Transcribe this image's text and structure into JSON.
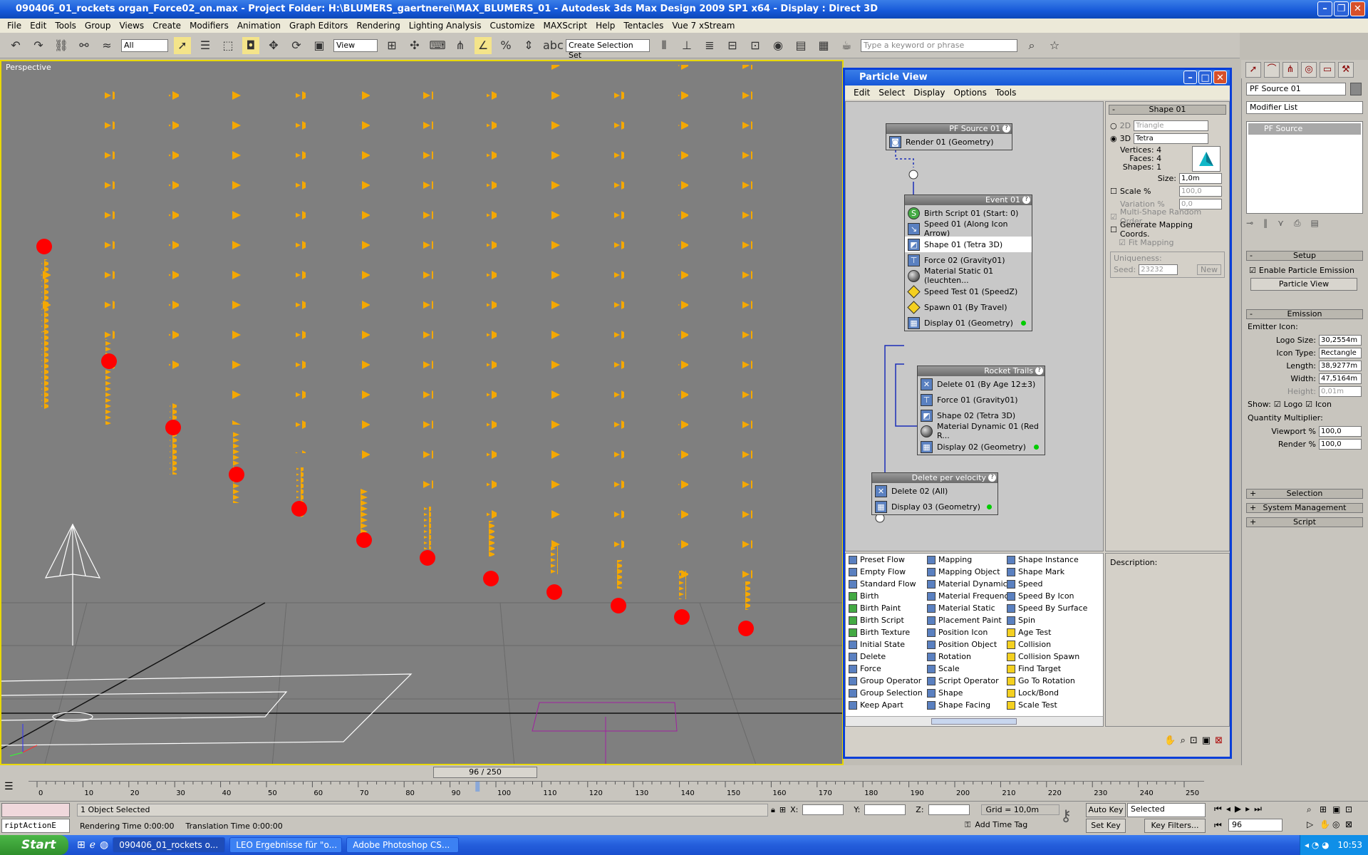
{
  "window": {
    "title": "090406_01_rockets organ_Force02_on.max     - Project Folder: H:\\BLUMERS_gaertnerei\\MAX_BLUMERS_01     - Autodesk 3ds Max Design 2009 SP1  x64      - Display : Direct 3D"
  },
  "menu": [
    "File",
    "Edit",
    "Tools",
    "Group",
    "Views",
    "Create",
    "Modifiers",
    "Animation",
    "Graph Editors",
    "Rendering",
    "Lighting Analysis",
    "Customize",
    "MAXScript",
    "Help",
    "Tentacles",
    "Vue 7 xStream"
  ],
  "toolbar": {
    "selection_filter": "All",
    "ref_coord": "View",
    "named_selection": "Create Selection Set",
    "search_placeholder": "Type a keyword or phrase"
  },
  "viewport": {
    "label": "Perspective"
  },
  "particle_view": {
    "title": "Particle View",
    "menu": [
      "Edit",
      "Select",
      "Display",
      "Options",
      "Tools"
    ],
    "pf_source": {
      "title": "PF Source 01",
      "ops": [
        "Render 01 (Geometry)"
      ]
    },
    "event01": {
      "title": "Event 01",
      "ops": [
        "Birth Script 01 (Start: 0)",
        "Speed 01 (Along Icon Arrow)",
        "Shape 01 (Tetra 3D)",
        "Force 02 (Gravity01)",
        "Material Static 01 (leuchten...",
        "Speed Test 01 (SpeedZ)",
        "Spawn 01 (By Travel)",
        "Display 01 (Geometry)"
      ]
    },
    "rocket_trails": {
      "title": "Rocket Trails",
      "ops": [
        "Delete 01 (By Age 12±3)",
        "Force 01 (Gravity01)",
        "Shape 02 (Tetra 3D)",
        "Material Dynamic 01 (Red R...",
        "Display 02 (Geometry)"
      ]
    },
    "delete_velocity": {
      "title": "Delete per velocity",
      "ops": [
        "Delete 02 (All)",
        "Display 03 (Geometry)"
      ]
    },
    "shape_panel": {
      "title": "Shape 01",
      "mode_2d": "2D",
      "shape_2d": "Triangle",
      "mode_3d": "3D",
      "shape_3d": "Tetra",
      "vertices": "Vertices: 4",
      "faces": "Faces: 4",
      "shapes": "Shapes: 1",
      "size_label": "Size:",
      "size": "1,0m",
      "scale_label": "Scale %",
      "scale": "100,0",
      "variation_label": "Variation %",
      "variation": "0,0",
      "multi_shape": "Multi-Shape Random Order",
      "gen_mapping": "Generate Mapping Coords.",
      "fit_mapping": "Fit Mapping",
      "uniqueness": "Uniqueness:",
      "seed_label": "Seed:",
      "seed": "23232",
      "new_button": "New"
    },
    "depot": {
      "col1": [
        "Preset Flow",
        "Empty Flow",
        "Standard Flow",
        "Birth",
        "Birth Paint",
        "Birth Script",
        "Birth Texture",
        "Initial State",
        "Delete",
        "Force",
        "Group Operator",
        "Group Selection",
        "Keep Apart"
      ],
      "col2": [
        "Mapping",
        "Mapping Object",
        "Material Dynamic",
        "Material Frequency",
        "Material Static",
        "Placement Paint",
        "Position Icon",
        "Position Object",
        "Rotation",
        "Scale",
        "Script Operator",
        "Shape",
        "Shape Facing"
      ],
      "col3": [
        "Shape Instance",
        "Shape Mark",
        "Speed",
        "Speed By Icon",
        "Speed By Surface",
        "Spin",
        "Age Test",
        "Collision",
        "Collision Spawn",
        "Find Target",
        "Go To Rotation",
        "Lock/Bond",
        "Scale Test"
      ]
    },
    "description_label": "Description:"
  },
  "command_panel": {
    "object_name": "PF Source 01",
    "modifier_list": "Modifier List",
    "stack_item": "PF Source",
    "setup": {
      "title": "Setup",
      "enable_emission": "Enable Particle Emission",
      "particle_view_button": "Particle View"
    },
    "emission": {
      "title": "Emission",
      "emitter_icon": "Emitter Icon:",
      "logo_size_label": "Logo Size:",
      "logo_size": "30,2554m",
      "icon_type_label": "Icon Type:",
      "icon_type": "Rectangle",
      "length_label": "Length:",
      "length": "38,9277m",
      "width_label": "Width:",
      "width": "47,5164m",
      "height_label": "Height:",
      "height": "0,01m",
      "show_label": "Show:",
      "logo_check": "Logo",
      "icon_check": "Icon",
      "quantity": "Quantity Multiplier:",
      "viewport_label": "Viewport %",
      "viewport_value": "100,0",
      "render_label": "Render %",
      "render_value": "100,0"
    },
    "rollouts": [
      "Selection",
      "System Management",
      "Script"
    ]
  },
  "timeline": {
    "frame_display": "96 / 250",
    "ticks": [
      "0",
      "10",
      "20",
      "30",
      "40",
      "50",
      "60",
      "70",
      "80",
      "90",
      "100",
      "110",
      "120",
      "130",
      "140",
      "150",
      "160",
      "170",
      "180",
      "190",
      "200",
      "210",
      "220",
      "230",
      "240",
      "250"
    ],
    "current_frame": 96,
    "total_frames": 250
  },
  "status": {
    "objects_selected": "1 Object Selected",
    "rendering_time": "Rendering Time  0:00:00",
    "translation_time": "Translation Time  0:00:00",
    "maxscript_listener": "riptActionE",
    "x_label": "X:",
    "y_label": "Y:",
    "z_label": "Z:",
    "grid": "Grid = 10,0m",
    "add_time_tag": "Add Time Tag",
    "auto_key": "Auto Key",
    "set_key": "Set Key",
    "key_mode": "Selected",
    "key_filters": "Key Filters...",
    "frame_field": "96"
  },
  "taskbar": {
    "start": "Start",
    "tasks": [
      "090406_01_rockets o...",
      "LEO Ergebnisse für \"o...",
      "Adobe Photoshop CS..."
    ],
    "clock": "10:53"
  },
  "colors": {
    "viewport_bg": "#7f7f7f",
    "particle_orange": "#f5a800",
    "rocket_red": "#ff0000",
    "title_blue": "#1658d8"
  }
}
